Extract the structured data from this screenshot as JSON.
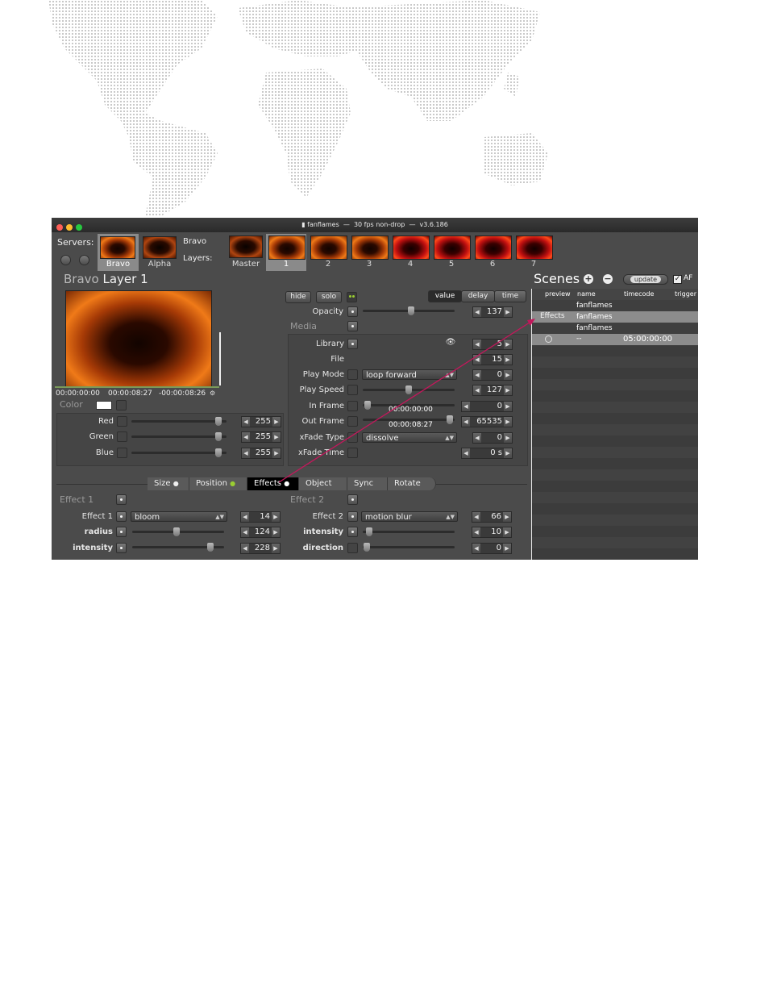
{
  "window": {
    "title": "fanflames",
    "fps": "30 fps non-drop",
    "version": "v3.6.186"
  },
  "servers": {
    "label": "Servers:",
    "items": [
      {
        "label": "Bravo"
      },
      {
        "label": "Alpha"
      }
    ]
  },
  "layers": {
    "server_name": "Bravo",
    "label": "Layers:",
    "items": [
      {
        "label": "Master"
      },
      {
        "label": "1"
      },
      {
        "label": "2"
      },
      {
        "label": "3"
      },
      {
        "label": "4"
      },
      {
        "label": "5"
      },
      {
        "label": "6"
      },
      {
        "label": "7"
      }
    ]
  },
  "layer_panel": {
    "title_prefix": "Bravo",
    "title": "Layer 1",
    "timecode_start": "00:00:00:00",
    "timecode_position": "00:00:08:27",
    "timecode_remaining": "-00:00:08:26",
    "color_label": "Color",
    "color_rows": [
      {
        "label": "Red",
        "value": "255"
      },
      {
        "label": "Green",
        "value": "255"
      },
      {
        "label": "Blue",
        "value": "255"
      }
    ]
  },
  "controls": {
    "hide": "hide",
    "solo": "solo",
    "mode_tabs": [
      "value",
      "delay",
      "time"
    ],
    "opacity": {
      "label": "Opacity",
      "value": "137"
    },
    "media_label": "Media",
    "rows": [
      {
        "label": "Library",
        "value": "5"
      },
      {
        "label": "File",
        "value": "15"
      },
      {
        "label": "Play Mode",
        "dropdown": "loop forward",
        "value": "0"
      },
      {
        "label": "Play Speed",
        "value": "127"
      },
      {
        "label": "In Frame",
        "timecode": "00:00:00:00",
        "value": "0"
      },
      {
        "label": "Out Frame",
        "timecode": "00:00:08:27",
        "value": "65535"
      },
      {
        "label": "xFade Type",
        "dropdown": "dissolve",
        "value": "0"
      },
      {
        "label": "xFade Time",
        "value": "0 s"
      }
    ]
  },
  "bottom_tabs": [
    "Size",
    "Position",
    "Effects",
    "Object",
    "Sync",
    "Rotate"
  ],
  "effect1": {
    "title": "Effect 1",
    "rows": [
      {
        "label": "Effect 1",
        "dropdown": "bloom",
        "value": "14"
      },
      {
        "label": "radius",
        "value": "124"
      },
      {
        "label": "intensity",
        "value": "228"
      }
    ]
  },
  "effect2": {
    "title": "Effect 2",
    "rows": [
      {
        "label": "Effect 2",
        "dropdown": "motion blur",
        "value": "66"
      },
      {
        "label": "intensity",
        "value": "10"
      },
      {
        "label": "direction",
        "value": "0"
      }
    ]
  },
  "scenes": {
    "title": "Scenes",
    "update_label": "update",
    "af_label": "AF",
    "columns": [
      "preview",
      "name",
      "timecode",
      "trigger"
    ],
    "rows": [
      {
        "preview": "",
        "name": "fanflames",
        "timecode": ""
      },
      {
        "preview": "Effects",
        "name": "fanflames",
        "timecode": ""
      },
      {
        "preview": "",
        "name": "fanflames",
        "timecode": ""
      },
      {
        "preview": "--",
        "name": "",
        "timecode": "05:00:00:00"
      }
    ]
  },
  "colors": {
    "window_bg": "#4b4b4b",
    "active_tab": "#000000",
    "callout_arrow": "#c2185b",
    "status_dot": "#9acd32"
  }
}
